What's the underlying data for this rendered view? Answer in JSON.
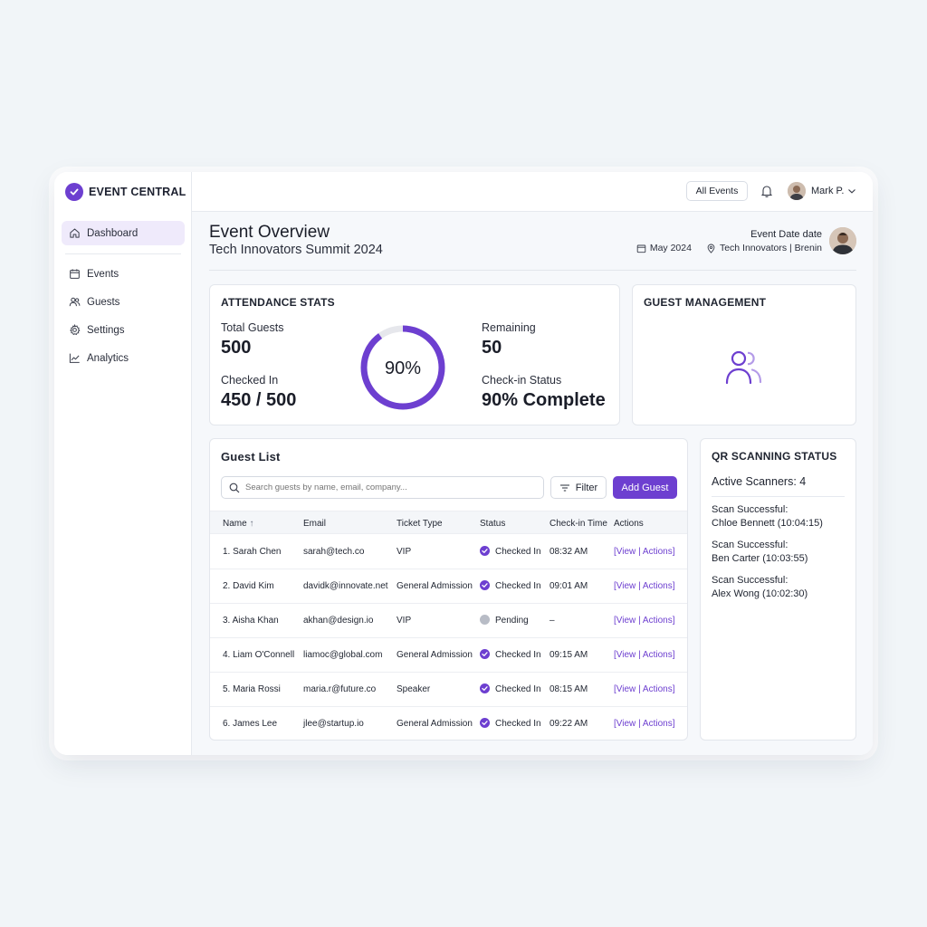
{
  "brand": {
    "name": "EVENT CENTRAL"
  },
  "sidebar": {
    "items": [
      {
        "label": "Dashboard"
      },
      {
        "label": "Events"
      },
      {
        "label": "Guests"
      },
      {
        "label": "Settings"
      },
      {
        "label": "Analytics"
      }
    ]
  },
  "topbar": {
    "all_events": "All Events",
    "user_name": "Mark P."
  },
  "overview": {
    "title": "Event Overview",
    "subtitle": "Tech Innovators Summit 2024",
    "date_label": "Event Date date",
    "date": "May 2024",
    "location": "Tech Innovators | Brenin"
  },
  "attendance": {
    "title": "ATTENDANCE STATS",
    "total_label": "Total Guests",
    "total_value": "500",
    "checked_label": "Checked In",
    "checked_value": "450 / 500",
    "remaining_label": "Remaining",
    "remaining_value": "50",
    "status_label": "Check-in Status",
    "status_value": "90% Complete",
    "ring_text": "90%",
    "ring_fraction": 0.9
  },
  "guest_management": {
    "title": "GUEST MANAGEMENT"
  },
  "guest_list": {
    "title": "Guest List",
    "search_placeholder": "Search guests by name, email, company...",
    "filter_label": "Filter",
    "add_label": "Add Guest",
    "columns": [
      "Name",
      "Email",
      "Ticket Type",
      "Status",
      "Check-in Time",
      "Actions"
    ],
    "sort_glyph": "↑",
    "rows": [
      {
        "name": "1. Sarah Chen",
        "email": "sarah@tech.co",
        "ticket": "VIP",
        "status": "Checked In",
        "time": "08:32 AM"
      },
      {
        "name": "2. David Kim",
        "email": "davidk@innovate.net",
        "ticket": "General Admission",
        "status": "Checked In",
        "time": "09:01 AM"
      },
      {
        "name": "3. Aisha Khan",
        "email": "akhan@design.io",
        "ticket": "VIP",
        "status": "Pending",
        "time": "–"
      },
      {
        "name": "4. Liam O'Connell",
        "email": "liamoc@global.com",
        "ticket": "General Admission",
        "status": "Checked In",
        "time": "09:15 AM"
      },
      {
        "name": "5. Maria Rossi",
        "email": "maria.r@future.co",
        "ticket": "Speaker",
        "status": "Checked In",
        "time": "08:15 AM"
      },
      {
        "name": "6. James Lee",
        "email": "jlee@startup.io",
        "ticket": "General Admission",
        "status": "Checked In",
        "time": "09:22 AM"
      }
    ],
    "action_view": "[View",
    "action_sep": "|",
    "action_actions": "Actions]"
  },
  "qr": {
    "title": "QR SCANNING STATUS",
    "active": "Active Scanners: 4",
    "scans": [
      {
        "label": "Scan Successful:",
        "detail": "Chloe Bennett (10:04:15)"
      },
      {
        "label": "Scan Successful:",
        "detail": "Ben Carter (10:03:55)"
      },
      {
        "label": "Scan Successful:",
        "detail": "Alex Wong (10:02:30)"
      }
    ]
  },
  "colors": {
    "accent": "#6d3fd0",
    "pending": "#b8bcc6",
    "ring_track": "#e6e7ec"
  }
}
